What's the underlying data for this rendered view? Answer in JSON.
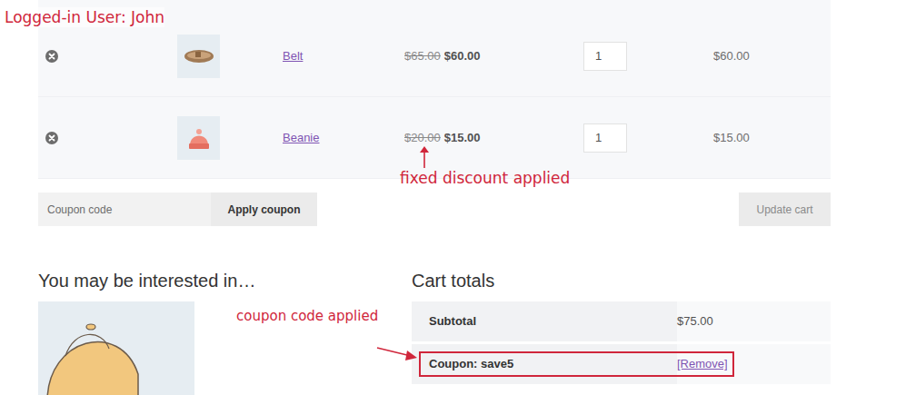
{
  "annotations": {
    "user": "Logged-in User: John",
    "discount_note": "fixed discount applied",
    "coupon_note": "coupon code applied"
  },
  "cart_items": [
    {
      "name": "Belt",
      "regular_price": "$65.00",
      "sale_price": "$60.00",
      "quantity": "1",
      "subtotal": "$60.00",
      "thumb": "belt"
    },
    {
      "name": "Beanie",
      "regular_price": "$20.00",
      "sale_price": "$15.00",
      "quantity": "1",
      "subtotal": "$15.00",
      "thumb": "beanie"
    }
  ],
  "coupon_field": {
    "placeholder": "Coupon code"
  },
  "buttons": {
    "apply": "Apply coupon",
    "update": "Update cart",
    "update_disabled": true
  },
  "cross_sells": {
    "title": "You may be interested in…"
  },
  "cart_totals": {
    "title": "Cart totals",
    "rows": [
      {
        "label": "Subtotal",
        "value": "$75.00",
        "kind": "amount",
        "highlighted": false
      },
      {
        "label": "Coupon: save5",
        "value": "[Remove]",
        "kind": "coupon",
        "highlighted": true
      }
    ]
  }
}
